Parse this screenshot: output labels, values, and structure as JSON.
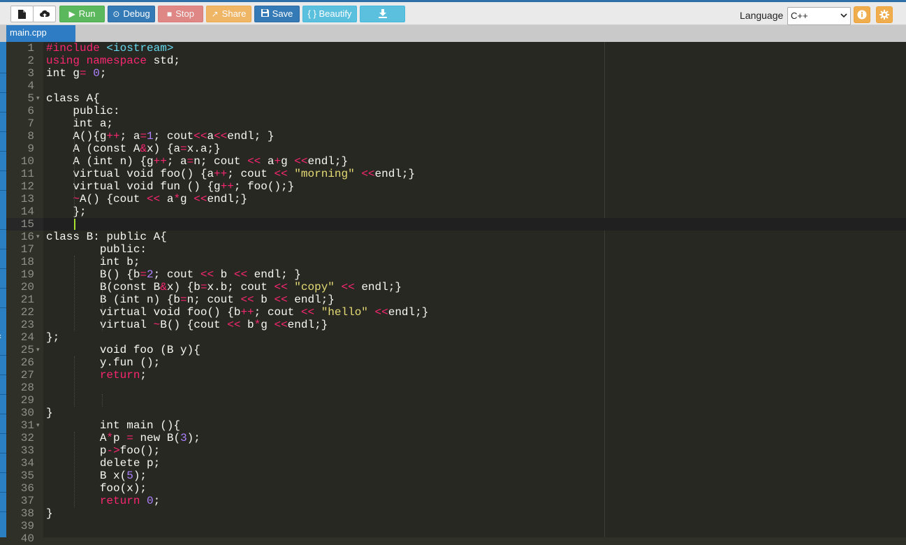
{
  "toolbar": {
    "new_file_icon": "file-icon",
    "upload_icon": "upload-icon",
    "run_label": "Run",
    "debug_label": "Debug",
    "stop_label": "Stop",
    "share_label": "Share",
    "save_label": "Save",
    "beautify_label": "{ } Beautify",
    "download_icon": "download-icon",
    "language_label": "Language",
    "language_value": "C++",
    "info_icon": "info-icon",
    "settings_icon": "gear-icon"
  },
  "colors": {
    "run": "#5cb85c",
    "debug": "#337ab7",
    "stop": "#d9534f",
    "share": "#f0ad4e",
    "save": "#337ab7",
    "beautify": "#5bc0de",
    "tab_active": "#2d7cc4",
    "editor_bg": "#272822"
  },
  "tabs": [
    {
      "label": "main.cpp",
      "active": true
    }
  ],
  "editor": {
    "active_line": 15,
    "lines": [
      {
        "n": "1",
        "fold": false
      },
      {
        "n": "2",
        "fold": false
      },
      {
        "n": "3",
        "fold": false
      },
      {
        "n": "4",
        "fold": false
      },
      {
        "n": "5",
        "fold": true
      },
      {
        "n": "6",
        "fold": false
      },
      {
        "n": "7",
        "fold": false
      },
      {
        "n": "8",
        "fold": false
      },
      {
        "n": "9",
        "fold": false
      },
      {
        "n": "10",
        "fold": false
      },
      {
        "n": "11",
        "fold": false
      },
      {
        "n": "12",
        "fold": false
      },
      {
        "n": "13",
        "fold": false
      },
      {
        "n": "14",
        "fold": false
      },
      {
        "n": "15",
        "fold": false
      },
      {
        "n": "16",
        "fold": true
      },
      {
        "n": "17",
        "fold": false
      },
      {
        "n": "18",
        "fold": false
      },
      {
        "n": "19",
        "fold": false
      },
      {
        "n": "20",
        "fold": false
      },
      {
        "n": "21",
        "fold": false
      },
      {
        "n": "22",
        "fold": false
      },
      {
        "n": "23",
        "fold": false
      },
      {
        "n": "24",
        "fold": false
      },
      {
        "n": "25",
        "fold": true
      },
      {
        "n": "26",
        "fold": false
      },
      {
        "n": "27",
        "fold": false
      },
      {
        "n": "28",
        "fold": false
      },
      {
        "n": "29",
        "fold": false
      },
      {
        "n": "30",
        "fold": false
      },
      {
        "n": "31",
        "fold": true
      },
      {
        "n": "32",
        "fold": false
      },
      {
        "n": "33",
        "fold": false
      },
      {
        "n": "34",
        "fold": false
      },
      {
        "n": "35",
        "fold": false
      },
      {
        "n": "36",
        "fold": false
      },
      {
        "n": "37",
        "fold": false
      },
      {
        "n": "38",
        "fold": false
      },
      {
        "n": "39",
        "fold": false
      },
      {
        "n": "40",
        "fold": false
      }
    ],
    "code": [
      [
        [
          "pp",
          "#include "
        ],
        [
          "kw2",
          "<iostream>"
        ]
      ],
      [
        [
          "kw",
          "using "
        ],
        [
          "kw",
          "namespace "
        ],
        [
          "",
          "std;"
        ]
      ],
      [
        [
          "",
          "int g"
        ],
        [
          "op",
          "="
        ],
        [
          "",
          " "
        ],
        [
          "num",
          "0"
        ],
        [
          "",
          ";"
        ]
      ],
      [],
      [
        [
          "",
          "class A{"
        ]
      ],
      [
        [
          "",
          "    public:"
        ]
      ],
      [
        [
          "",
          "    int a;"
        ]
      ],
      [
        [
          "",
          "    A(){g"
        ],
        [
          "op",
          "++"
        ],
        [
          "",
          "; a"
        ],
        [
          "op",
          "="
        ],
        [
          "num",
          "1"
        ],
        [
          "",
          "; cout"
        ],
        [
          "op",
          "<<"
        ],
        [
          "",
          "a"
        ],
        [
          "op",
          "<<"
        ],
        [
          "",
          "endl; }"
        ]
      ],
      [
        [
          "",
          "    A (const A"
        ],
        [
          "op",
          "&"
        ],
        [
          "",
          "x) {a"
        ],
        [
          "op",
          "="
        ],
        [
          "",
          "x.a;}"
        ]
      ],
      [
        [
          "",
          "    A (int n) {g"
        ],
        [
          "op",
          "++"
        ],
        [
          "",
          "; a"
        ],
        [
          "op",
          "="
        ],
        [
          "",
          "n; cout "
        ],
        [
          "op",
          "<<"
        ],
        [
          "",
          " a"
        ],
        [
          "op",
          "+"
        ],
        [
          "",
          "g "
        ],
        [
          "op",
          "<<"
        ],
        [
          "",
          "endl;}"
        ]
      ],
      [
        [
          "",
          "    virtual void foo() {a"
        ],
        [
          "op",
          "++"
        ],
        [
          "",
          "; cout "
        ],
        [
          "op",
          "<<"
        ],
        [
          "",
          " "
        ],
        [
          "str",
          "\"morning\""
        ],
        [
          "",
          " "
        ],
        [
          "op",
          "<<"
        ],
        [
          "",
          "endl;}"
        ]
      ],
      [
        [
          "",
          "    virtual void fun () {g"
        ],
        [
          "op",
          "++"
        ],
        [
          "",
          "; foo();}"
        ]
      ],
      [
        [
          "",
          "    "
        ],
        [
          "op",
          "~"
        ],
        [
          "",
          "A() {cout "
        ],
        [
          "op",
          "<<"
        ],
        [
          "",
          " a"
        ],
        [
          "op",
          "*"
        ],
        [
          "",
          "g "
        ],
        [
          "op",
          "<<"
        ],
        [
          "",
          "endl;}"
        ]
      ],
      [
        [
          "",
          "    };"
        ]
      ],
      [],
      [
        [
          "",
          "class B: public A{"
        ]
      ],
      [
        [
          "",
          "        public:"
        ]
      ],
      [
        [
          "",
          "        int b;"
        ]
      ],
      [
        [
          "",
          "        B() {b"
        ],
        [
          "op",
          "="
        ],
        [
          "num",
          "2"
        ],
        [
          "",
          "; cout "
        ],
        [
          "op",
          "<<"
        ],
        [
          "",
          " b "
        ],
        [
          "op",
          "<<"
        ],
        [
          "",
          " endl; }"
        ]
      ],
      [
        [
          "",
          "        B(const B"
        ],
        [
          "op",
          "&"
        ],
        [
          "",
          "x) {b"
        ],
        [
          "op",
          "="
        ],
        [
          "",
          "x.b; cout "
        ],
        [
          "op",
          "<<"
        ],
        [
          "",
          " "
        ],
        [
          "str",
          "\"copy\""
        ],
        [
          "",
          " "
        ],
        [
          "op",
          "<<"
        ],
        [
          "",
          " endl;}"
        ]
      ],
      [
        [
          "",
          "        B (int n) {b"
        ],
        [
          "op",
          "="
        ],
        [
          "",
          "n; cout "
        ],
        [
          "op",
          "<<"
        ],
        [
          "",
          " b "
        ],
        [
          "op",
          "<<"
        ],
        [
          "",
          " endl;}"
        ]
      ],
      [
        [
          "",
          "        virtual void foo() {b"
        ],
        [
          "op",
          "++"
        ],
        [
          "",
          "; cout "
        ],
        [
          "op",
          "<<"
        ],
        [
          "",
          " "
        ],
        [
          "str",
          "\"hello\""
        ],
        [
          "",
          " "
        ],
        [
          "op",
          "<<"
        ],
        [
          "",
          "endl;}"
        ]
      ],
      [
        [
          "",
          "        virtual "
        ],
        [
          "op",
          "~"
        ],
        [
          "",
          "B() {cout "
        ],
        [
          "op",
          "<<"
        ],
        [
          "",
          " b"
        ],
        [
          "op",
          "*"
        ],
        [
          "",
          "g "
        ],
        [
          "op",
          "<<"
        ],
        [
          "",
          "endl;}"
        ]
      ],
      [
        [
          "",
          "};"
        ]
      ],
      [
        [
          "",
          "        void foo (B y){"
        ]
      ],
      [
        [
          "",
          "        y.fun ();"
        ]
      ],
      [
        [
          "",
          "        "
        ],
        [
          "kw",
          "return"
        ],
        [
          "",
          ";"
        ]
      ],
      [],
      [],
      [
        [
          "",
          "}"
        ]
      ],
      [
        [
          "",
          "        int main (){"
        ]
      ],
      [
        [
          "",
          "        A"
        ],
        [
          "op",
          "*"
        ],
        [
          "",
          "p "
        ],
        [
          "op",
          "="
        ],
        [
          "",
          " new B("
        ],
        [
          "num",
          "3"
        ],
        [
          "",
          ");"
        ]
      ],
      [
        [
          "",
          "        p"
        ],
        [
          "op",
          "->"
        ],
        [
          "",
          "foo();"
        ]
      ],
      [
        [
          "",
          "        delete p;"
        ]
      ],
      [
        [
          "",
          "        B x("
        ],
        [
          "num",
          "5"
        ],
        [
          "",
          ");"
        ]
      ],
      [
        [
          "",
          "        foo(x);"
        ]
      ],
      [
        [
          "",
          "        "
        ],
        [
          "kw",
          "return "
        ],
        [
          "num",
          "0"
        ],
        [
          "",
          ";"
        ]
      ],
      [
        [
          "",
          "}"
        ]
      ],
      [],
      []
    ]
  }
}
